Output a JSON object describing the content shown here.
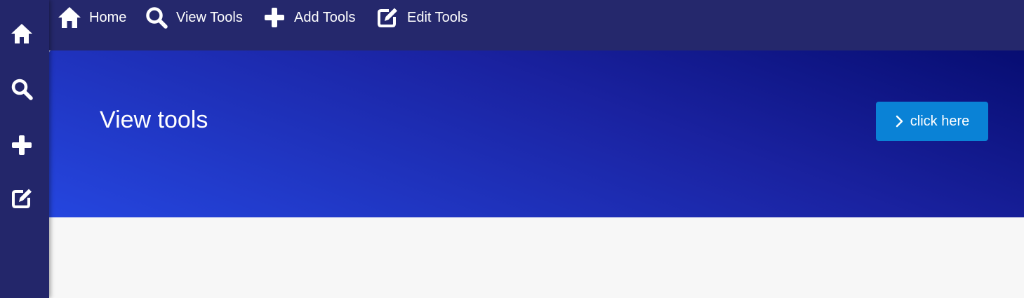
{
  "sidebar": {
    "items": [
      {
        "icon": "home-icon"
      },
      {
        "icon": "search-icon"
      },
      {
        "icon": "plus-icon"
      },
      {
        "icon": "edit-icon"
      }
    ]
  },
  "topnav": {
    "items": [
      {
        "label": "Home",
        "icon": "home-icon"
      },
      {
        "label": "View Tools",
        "icon": "search-icon"
      },
      {
        "label": "Add Tools",
        "icon": "plus-icon"
      },
      {
        "label": "Edit Tools",
        "icon": "edit-icon"
      }
    ]
  },
  "hero": {
    "title": "View tools",
    "button_label": "click here",
    "button_icon": "chevron-right-icon"
  },
  "colors": {
    "sidebar": "#23266a",
    "topbar": "#25286c",
    "button": "#0a82d6",
    "background": "#f7f7f7"
  }
}
